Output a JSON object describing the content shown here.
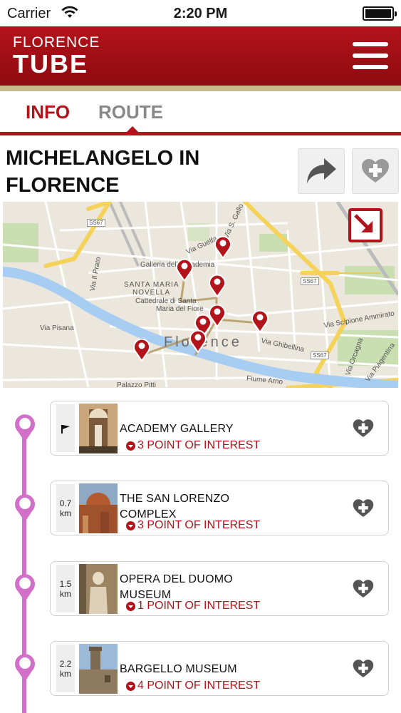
{
  "status_bar": {
    "carrier": "Carrier",
    "time": "2:20 PM"
  },
  "header": {
    "logo_line1": "FLORENCE",
    "logo_line2": "TUBE"
  },
  "tabs": [
    {
      "label": "INFO",
      "active": true
    },
    {
      "label": "ROUTE",
      "active": false
    }
  ],
  "route": {
    "title_line1": "MICHELANGELO IN",
    "title_line2": "FLORENCE"
  },
  "map": {
    "labels": {
      "road_ss67_top": "SS67",
      "road_ss67_right": "SS67",
      "road_ss67_bottom": "SS67",
      "gallery": "Galleria dell'Accademia",
      "santa_maria_1": "SANTA MARIA",
      "santa_maria_2": "NOVELLA",
      "cathedral_1": "Cattedrale di Santa",
      "cathedral_2": "Maria del Fiore",
      "city": "Florence",
      "via_pisana": "Via Pisana",
      "via_guelfa": "Via Guelfa",
      "via_ghibellina": "Via Ghibellina",
      "via_scipione": "Via Scipione Ammirato",
      "via_orcagna": "Via Orcagna",
      "via_piagentina": "Via Piagentina",
      "via_sgallo": "Via S. Gallo",
      "fiume_arno": "Fiume Arno",
      "palazzo_pitti": "Palazzo Pitti",
      "via_il_prato": "Via Il Prato"
    }
  },
  "stops": [
    {
      "distance_value": "",
      "distance_unit": "",
      "flag": true,
      "name": "ACADEMY GALLERY",
      "poi": "3 POINT OF INTEREST"
    },
    {
      "distance_value": "0.7",
      "distance_unit": "km",
      "flag": false,
      "name": "THE SAN LORENZO COMPLEX",
      "poi": "3 POINT OF INTEREST"
    },
    {
      "distance_value": "1.5",
      "distance_unit": "km",
      "flag": false,
      "name": "OPERA DEL DUOMO MUSEUM",
      "poi": "1 POINT OF INTEREST"
    },
    {
      "distance_value": "2.2",
      "distance_unit": "km",
      "flag": false,
      "name": "BARGELLO MUSEUM",
      "poi": "4 POINT OF INTEREST"
    }
  ],
  "colors": {
    "brand_red": "#b3131a",
    "timeline_pink": "#d26fc8",
    "header_gold": "#c9b98a"
  },
  "icons": {
    "menu": "hamburger-icon",
    "share": "share-arrow-icon",
    "favorite": "heart-plus-icon",
    "expand": "expand-arrow-icon",
    "poi": "chevron-down-circle-icon",
    "start": "flag-icon"
  }
}
